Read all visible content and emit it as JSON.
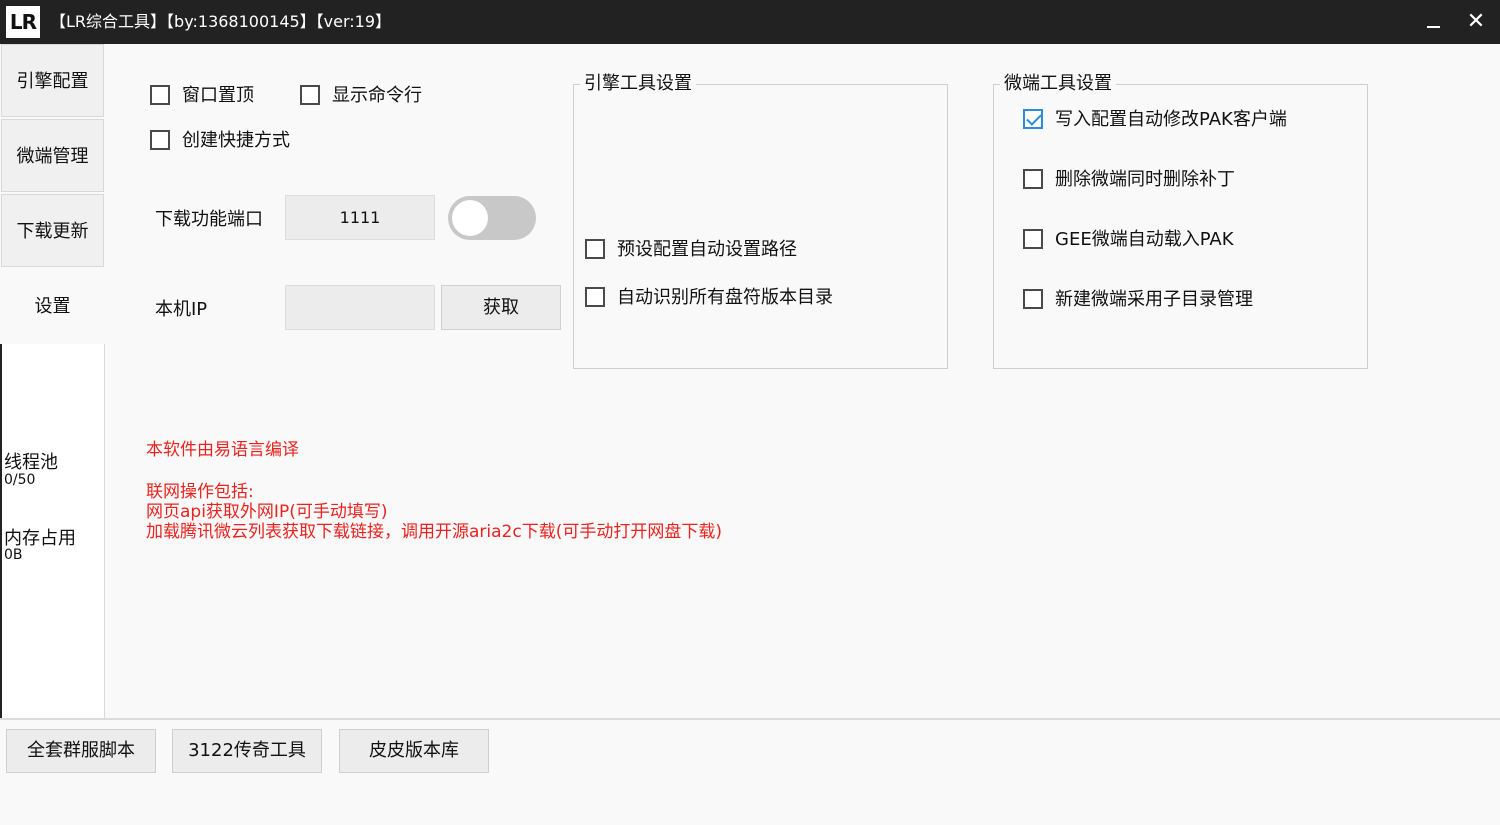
{
  "titlebar": {
    "logo": "LR",
    "title": "【LR综合工具】【by:1368100145】【ver:19】",
    "minimize_icon": "minimize-icon",
    "close_icon": "close-icon",
    "close_glyph": "✕"
  },
  "sidebar": {
    "tabs": [
      {
        "label": "引擎配置"
      },
      {
        "label": "微端管理"
      },
      {
        "label": "下载更新"
      },
      {
        "label": "设置",
        "active": true
      }
    ],
    "thread_pool_label": "线程池",
    "thread_pool_value": "0/50",
    "memory_label": "内存占用",
    "memory_value": "0B"
  },
  "settings": {
    "window_top": {
      "label": "窗口置顶",
      "checked": false
    },
    "show_cmd": {
      "label": "显示命令行",
      "checked": false
    },
    "create_shortcut": {
      "label": "创建快捷方式",
      "checked": false
    },
    "download_port_label": "下载功能端口",
    "download_port_value": "1111",
    "toggle_on": false,
    "local_ip_label": "本机IP",
    "local_ip_value": "",
    "fetch_button": "获取"
  },
  "engine_group": {
    "title": "引擎工具设置",
    "options": [
      {
        "label": "预设配置自动设置路径",
        "checked": false
      },
      {
        "label": "自动识别所有盘符版本目录",
        "checked": false
      }
    ]
  },
  "micro_group": {
    "title": "微端工具设置",
    "options": [
      {
        "label": "写入配置自动修改PAK客户端",
        "checked": true
      },
      {
        "label": "删除微端同时删除补丁",
        "checked": false
      },
      {
        "label": "GEE微端自动载入PAK",
        "checked": false
      },
      {
        "label": "新建微端采用子目录管理",
        "checked": false
      }
    ]
  },
  "notes": {
    "line1": "本软件由易语言编译",
    "line2": "联网操作包括:",
    "line3": "网页api获取外网IP(可手动填写)",
    "line4": "加载腾讯微云列表获取下载链接，调用开源aria2c下载(可手动打开网盘下载)"
  },
  "colors": {
    "titlebar_bg": "#222222",
    "note_red": "#e8231f",
    "check_blue": "#2c8bd8"
  },
  "bottom_buttons": [
    {
      "label": "全套群服脚本"
    },
    {
      "label": "3122传奇工具"
    },
    {
      "label": "皮皮版本库"
    }
  ]
}
